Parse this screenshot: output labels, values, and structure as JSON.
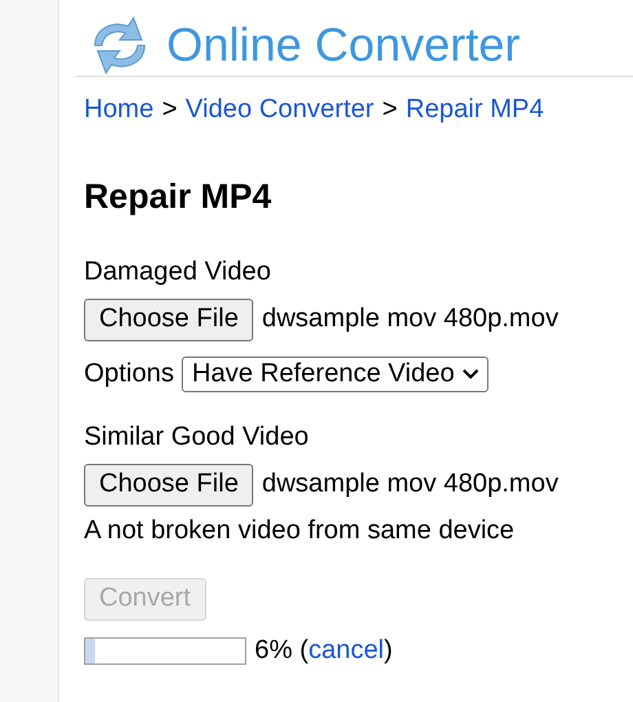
{
  "logo": {
    "text": "Online Converter"
  },
  "breadcrumb": [
    {
      "text": "Home"
    },
    {
      "text": "Video Converter"
    },
    {
      "text": "Repair MP4"
    }
  ],
  "breadcrumb_separator": ">",
  "title": "Repair MP4",
  "damaged_video": {
    "label": "Damaged Video",
    "button": "Choose File",
    "file": "dwsample mov 480p.mov"
  },
  "options": {
    "label": "Options",
    "value": "Have Reference Video"
  },
  "good_video": {
    "label": "Similar Good Video",
    "button": "Choose File",
    "file": "dwsample mov 480p.mov",
    "hint": "A not broken video from same device"
  },
  "convert_button": {
    "label": "Convert",
    "disabled": true
  },
  "progress": {
    "level": 0.06,
    "text": "6%",
    "open": "(",
    "link": "cancel",
    "close": ")"
  }
}
